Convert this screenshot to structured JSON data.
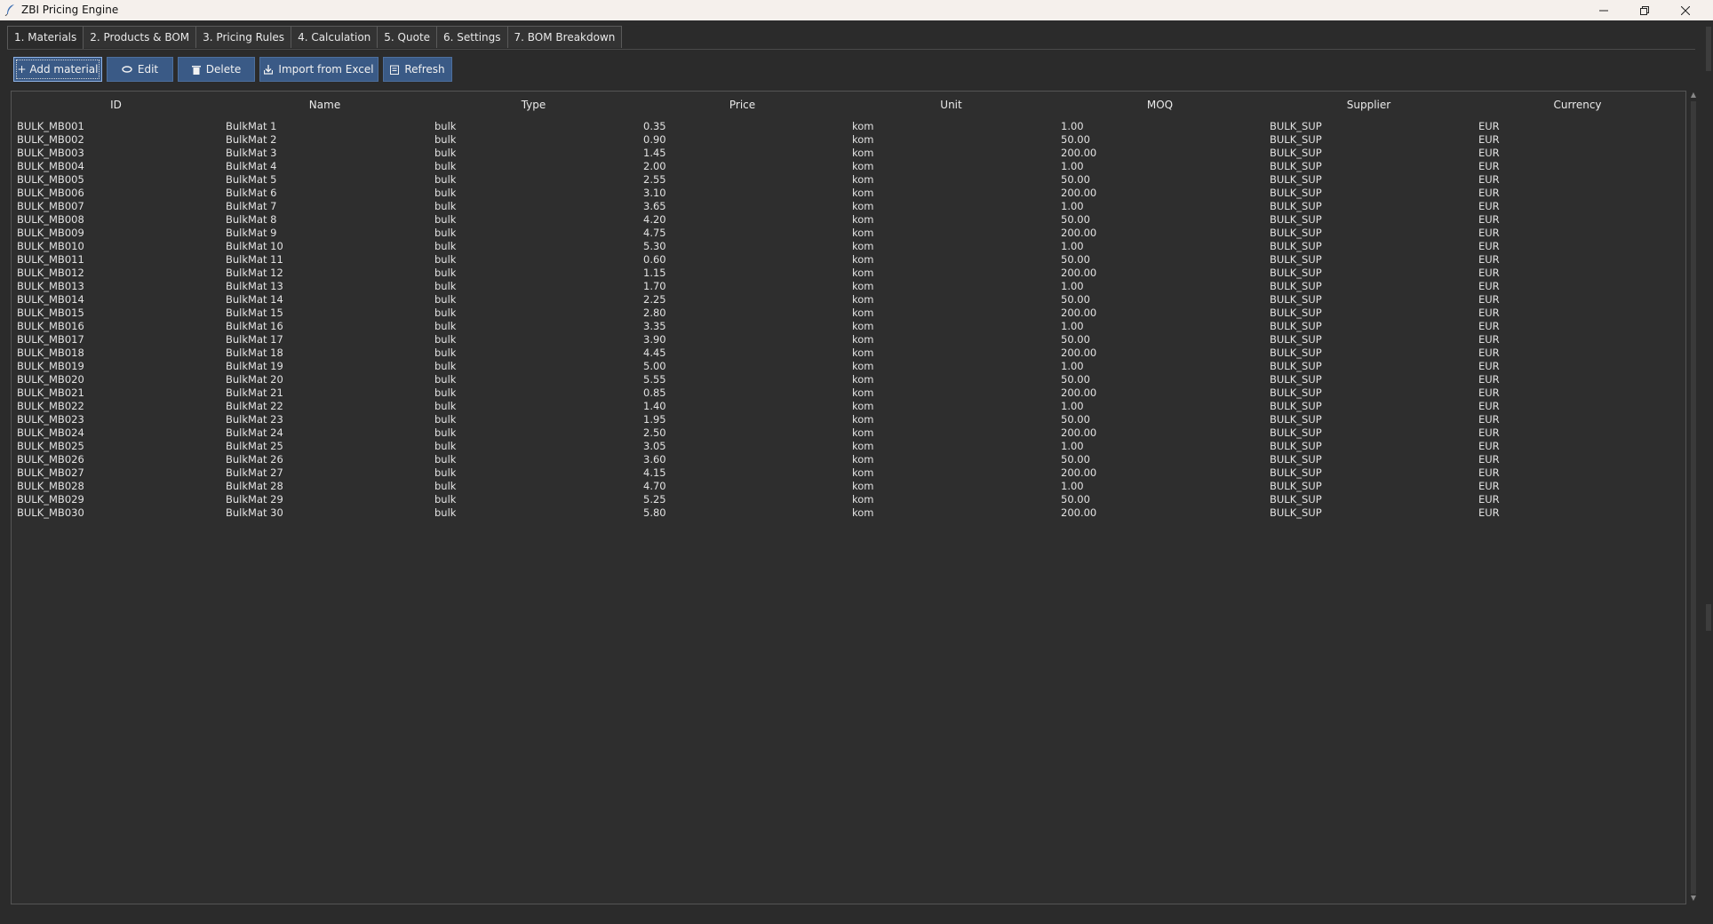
{
  "window": {
    "title": "ZBI Pricing Engine"
  },
  "tabs": [
    {
      "label": "1. Materials"
    },
    {
      "label": "2. Products & BOM"
    },
    {
      "label": "3. Pricing Rules"
    },
    {
      "label": "4. Calculation"
    },
    {
      "label": "5. Quote"
    },
    {
      "label": "6. Settings"
    },
    {
      "label": "7. BOM Breakdown"
    }
  ],
  "active_tab": 0,
  "toolbar": {
    "add_label": "+ Add material",
    "edit_label": "Edit",
    "delete_label": "Delete",
    "import_label": "Import from Excel",
    "refresh_label": "Refresh"
  },
  "table": {
    "columns": [
      "ID",
      "Name",
      "Type",
      "Price",
      "Unit",
      "MOQ",
      "Supplier",
      "Currency"
    ],
    "rows": [
      [
        "BULK_MB001",
        "BulkMat 1",
        "bulk",
        "0.35",
        "kom",
        "1.00",
        "BULK_SUP",
        "EUR"
      ],
      [
        "BULK_MB002",
        "BulkMat 2",
        "bulk",
        "0.90",
        "kom",
        "50.00",
        "BULK_SUP",
        "EUR"
      ],
      [
        "BULK_MB003",
        "BulkMat 3",
        "bulk",
        "1.45",
        "kom",
        "200.00",
        "BULK_SUP",
        "EUR"
      ],
      [
        "BULK_MB004",
        "BulkMat 4",
        "bulk",
        "2.00",
        "kom",
        "1.00",
        "BULK_SUP",
        "EUR"
      ],
      [
        "BULK_MB005",
        "BulkMat 5",
        "bulk",
        "2.55",
        "kom",
        "50.00",
        "BULK_SUP",
        "EUR"
      ],
      [
        "BULK_MB006",
        "BulkMat 6",
        "bulk",
        "3.10",
        "kom",
        "200.00",
        "BULK_SUP",
        "EUR"
      ],
      [
        "BULK_MB007",
        "BulkMat 7",
        "bulk",
        "3.65",
        "kom",
        "1.00",
        "BULK_SUP",
        "EUR"
      ],
      [
        "BULK_MB008",
        "BulkMat 8",
        "bulk",
        "4.20",
        "kom",
        "50.00",
        "BULK_SUP",
        "EUR"
      ],
      [
        "BULK_MB009",
        "BulkMat 9",
        "bulk",
        "4.75",
        "kom",
        "200.00",
        "BULK_SUP",
        "EUR"
      ],
      [
        "BULK_MB010",
        "BulkMat 10",
        "bulk",
        "5.30",
        "kom",
        "1.00",
        "BULK_SUP",
        "EUR"
      ],
      [
        "BULK_MB011",
        "BulkMat 11",
        "bulk",
        "0.60",
        "kom",
        "50.00",
        "BULK_SUP",
        "EUR"
      ],
      [
        "BULK_MB012",
        "BulkMat 12",
        "bulk",
        "1.15",
        "kom",
        "200.00",
        "BULK_SUP",
        "EUR"
      ],
      [
        "BULK_MB013",
        "BulkMat 13",
        "bulk",
        "1.70",
        "kom",
        "1.00",
        "BULK_SUP",
        "EUR"
      ],
      [
        "BULK_MB014",
        "BulkMat 14",
        "bulk",
        "2.25",
        "kom",
        "50.00",
        "BULK_SUP",
        "EUR"
      ],
      [
        "BULK_MB015",
        "BulkMat 15",
        "bulk",
        "2.80",
        "kom",
        "200.00",
        "BULK_SUP",
        "EUR"
      ],
      [
        "BULK_MB016",
        "BulkMat 16",
        "bulk",
        "3.35",
        "kom",
        "1.00",
        "BULK_SUP",
        "EUR"
      ],
      [
        "BULK_MB017",
        "BulkMat 17",
        "bulk",
        "3.90",
        "kom",
        "50.00",
        "BULK_SUP",
        "EUR"
      ],
      [
        "BULK_MB018",
        "BulkMat 18",
        "bulk",
        "4.45",
        "kom",
        "200.00",
        "BULK_SUP",
        "EUR"
      ],
      [
        "BULK_MB019",
        "BulkMat 19",
        "bulk",
        "5.00",
        "kom",
        "1.00",
        "BULK_SUP",
        "EUR"
      ],
      [
        "BULK_MB020",
        "BulkMat 20",
        "bulk",
        "5.55",
        "kom",
        "50.00",
        "BULK_SUP",
        "EUR"
      ],
      [
        "BULK_MB021",
        "BulkMat 21",
        "bulk",
        "0.85",
        "kom",
        "200.00",
        "BULK_SUP",
        "EUR"
      ],
      [
        "BULK_MB022",
        "BulkMat 22",
        "bulk",
        "1.40",
        "kom",
        "1.00",
        "BULK_SUP",
        "EUR"
      ],
      [
        "BULK_MB023",
        "BulkMat 23",
        "bulk",
        "1.95",
        "kom",
        "50.00",
        "BULK_SUP",
        "EUR"
      ],
      [
        "BULK_MB024",
        "BulkMat 24",
        "bulk",
        "2.50",
        "kom",
        "200.00",
        "BULK_SUP",
        "EUR"
      ],
      [
        "BULK_MB025",
        "BulkMat 25",
        "bulk",
        "3.05",
        "kom",
        "1.00",
        "BULK_SUP",
        "EUR"
      ],
      [
        "BULK_MB026",
        "BulkMat 26",
        "bulk",
        "3.60",
        "kom",
        "50.00",
        "BULK_SUP",
        "EUR"
      ],
      [
        "BULK_MB027",
        "BulkMat 27",
        "bulk",
        "4.15",
        "kom",
        "200.00",
        "BULK_SUP",
        "EUR"
      ],
      [
        "BULK_MB028",
        "BulkMat 28",
        "bulk",
        "4.70",
        "kom",
        "1.00",
        "BULK_SUP",
        "EUR"
      ],
      [
        "BULK_MB029",
        "BulkMat 29",
        "bulk",
        "5.25",
        "kom",
        "50.00",
        "BULK_SUP",
        "EUR"
      ],
      [
        "BULK_MB030",
        "BulkMat 30",
        "bulk",
        "5.80",
        "kom",
        "200.00",
        "BULK_SUP",
        "EUR"
      ]
    ]
  },
  "icons": {
    "app": "feather-icon",
    "edit": "pencil-icon",
    "delete": "trash-icon",
    "import": "import-icon",
    "refresh": "refresh-icon"
  },
  "colors": {
    "background": "#2b2b2b",
    "button": "#3a5a86",
    "titlebar": "#f5f0ec"
  }
}
